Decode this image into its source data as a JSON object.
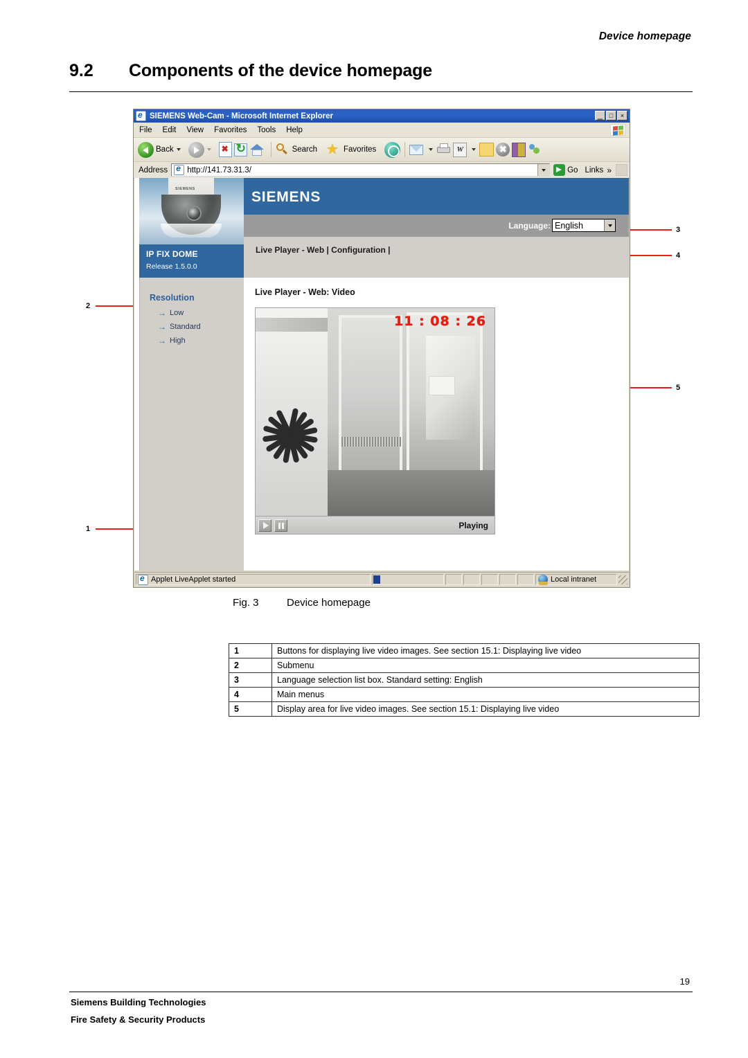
{
  "page": {
    "running_head": "Device homepage",
    "section_number": "9.2",
    "section_title": "Components of the device homepage",
    "page_number": "19",
    "footer_line1": "Siemens Building Technologies",
    "footer_line2": "Fire Safety & Security Products"
  },
  "figure": {
    "caption_label": "Fig. 3",
    "caption_text": "Device homepage",
    "callouts": [
      "1",
      "2",
      "3",
      "4",
      "5"
    ]
  },
  "browser": {
    "title": "SIEMENS Web-Cam - Microsoft Internet Explorer",
    "window_buttons": {
      "minimize": "_",
      "maximize": "□",
      "close": "×"
    },
    "menu_items": [
      "File",
      "Edit",
      "View",
      "Favorites",
      "Tools",
      "Help"
    ],
    "toolbar": {
      "back_label": "Back",
      "search_label": "Search",
      "favorites_label": "Favorites",
      "word_glyph": "W",
      "x_glyph": "✖"
    },
    "address": {
      "label": "Address",
      "url": "http://141.73.31.3/",
      "go_label": "Go",
      "links_label": "Links",
      "chevron": "»"
    },
    "statusbar": {
      "message": "Applet LiveApplet started",
      "zone": "Local intranet"
    }
  },
  "webpage": {
    "brand": "SIEMENS",
    "camera_label": "SIEMENS",
    "language": {
      "label": "Language:",
      "value": "English"
    },
    "device": {
      "name": "IP FIX DOME",
      "release": "Release 1.5.0.0"
    },
    "main_menu": "Live Player - Web  |  Configuration  |",
    "sidebar": {
      "heading": "Resolution",
      "arrow_glyph": "→",
      "items": [
        "Low",
        "Standard",
        "High"
      ]
    },
    "content": {
      "title": "Live Player - Web: Video",
      "video_timestamp": "11 : 08 : 26",
      "player_status": "Playing"
    }
  },
  "legend_table": {
    "rows": [
      {
        "num": "1",
        "text": "Buttons for displaying live video images. See section 15.1: Displaying live video"
      },
      {
        "num": "2",
        "text": "Submenu"
      },
      {
        "num": "3",
        "text": "Language selection list box. Standard setting: English"
      },
      {
        "num": "4",
        "text": "Main menus"
      },
      {
        "num": "5",
        "text": "Display area for live video images. See section 15.1: Displaying live video"
      }
    ]
  },
  "colors": {
    "siemens_blue": "#30679f",
    "callout_red": "#ee1b18",
    "link_blue": "#2f5f96",
    "timestamp_red": "#e81b0e"
  }
}
